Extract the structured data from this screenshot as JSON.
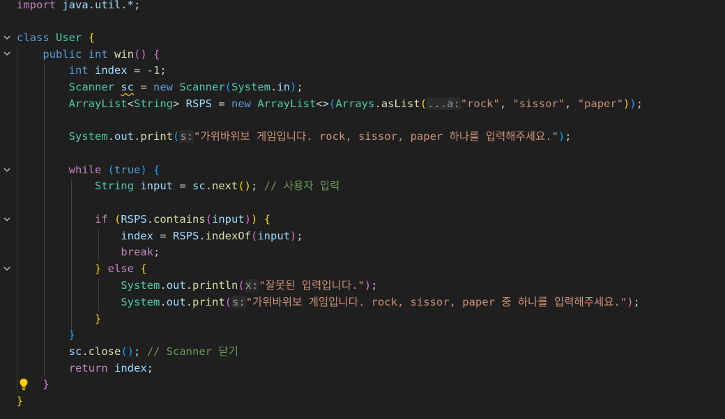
{
  "editor": {
    "import_kw": "import",
    "import_path": "java.util.*",
    "class_kw": "class",
    "class_name": "User",
    "method": {
      "mods": "public",
      "ret": "int",
      "name": "win"
    },
    "index_decl": {
      "type": "int",
      "name": "index",
      "value": "-1"
    },
    "scanner_decl": {
      "type": "Scanner",
      "name": "sc",
      "new": "new",
      "ctor": "Scanner",
      "arg_class": "System",
      "arg_field": "in"
    },
    "list_decl": {
      "type": "ArrayList",
      "generic": "String",
      "name": "RSPS",
      "new": "new",
      "ctor": "ArrayList",
      "util": "Arrays",
      "method": "asList",
      "hint": "...a:",
      "items": [
        "\"rock\"",
        "\"sissor\"",
        "\"paper\""
      ]
    },
    "print1": {
      "cls": "System",
      "field": "out",
      "method": "print",
      "hint": "s:",
      "text": "\"가위바위보 게임입니다. rock, sissor, paper 하나를 입력해주세요.\""
    },
    "while_kw": "while",
    "while_cond": "true",
    "input_decl": {
      "type": "String",
      "name": "input",
      "obj": "sc",
      "method": "next",
      "comment": "// 사용자 입력"
    },
    "if_kw": "if",
    "if_cond": {
      "obj": "RSPS",
      "method": "contains",
      "arg": "input"
    },
    "assign": {
      "name": "index",
      "obj": "RSPS",
      "method": "indexOf",
      "arg": "input"
    },
    "break_kw": "break",
    "else_kw": "else",
    "println": {
      "cls": "System",
      "field": "out",
      "method": "println",
      "hint": "x:",
      "text": "\"잘못된 입력입니다.\""
    },
    "print2": {
      "cls": "System",
      "field": "out",
      "method": "print",
      "hint": "s:",
      "text": "\"가위바위보 게임입니다. rock, sissor, paper 중 하나를 입력해주세요.\""
    },
    "close": {
      "obj": "sc",
      "method": "close",
      "comment": "// Scanner 닫기"
    },
    "return_kw": "return",
    "return_val": "index"
  },
  "icons": [
    "chevron-down-icon",
    "lightbulb-icon"
  ]
}
